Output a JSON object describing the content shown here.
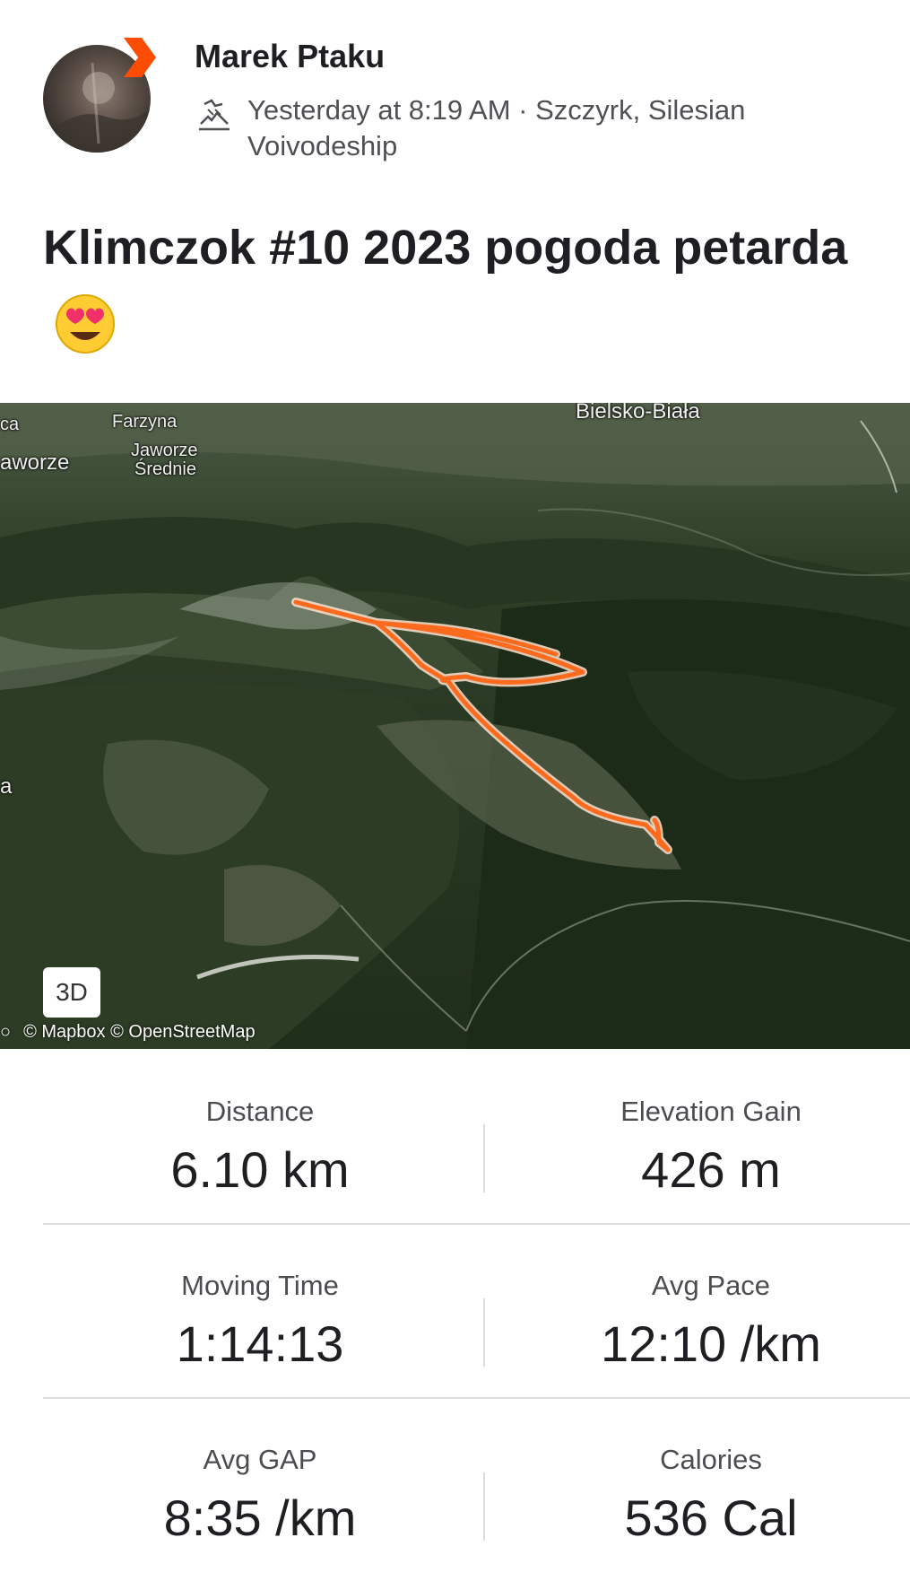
{
  "activity": {
    "athlete_name": "Marek Ptaku",
    "meta": "Yesterday at 8:19 AM · Szczyrk, Silesian Voivodeship",
    "title": "Klimczok #10 2023 pogoda petarda",
    "title_emoji": "😍"
  },
  "map": {
    "labels": {
      "bielsko": "Bielsko-Biała",
      "farzyna": "Farzyna",
      "jaworze_srednie_1": "Jaworze",
      "jaworze_srednie_2": "Średnie",
      "left_ca": "ca",
      "left_jaworze": "aworze",
      "left_a": "a"
    },
    "button_3d": "3D",
    "attribution": "© Mapbox © OpenStreetMap",
    "route_color": "#fc6a1e"
  },
  "stats": [
    {
      "label": "Distance",
      "value": "6.10 km"
    },
    {
      "label": "Elevation Gain",
      "value": "426 m"
    },
    {
      "label": "Moving Time",
      "value": "1:14:13"
    },
    {
      "label": "Avg Pace",
      "value": "12:10 /km"
    },
    {
      "label": "Avg GAP",
      "value": "8:35 /km"
    },
    {
      "label": "Calories",
      "value": "536 Cal"
    }
  ]
}
